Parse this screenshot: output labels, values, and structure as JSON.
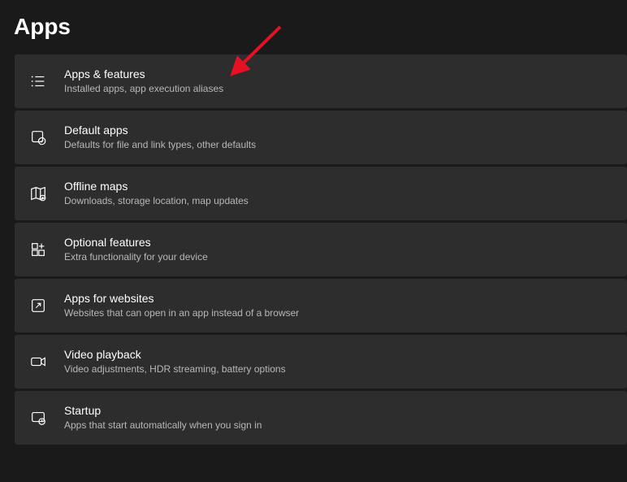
{
  "page": {
    "title": "Apps"
  },
  "items": [
    {
      "title": "Apps & features",
      "subtitle": "Installed apps, app execution aliases"
    },
    {
      "title": "Default apps",
      "subtitle": "Defaults for file and link types, other defaults"
    },
    {
      "title": "Offline maps",
      "subtitle": "Downloads, storage location, map updates"
    },
    {
      "title": "Optional features",
      "subtitle": "Extra functionality for your device"
    },
    {
      "title": "Apps for websites",
      "subtitle": "Websites that can open in an app instead of a browser"
    },
    {
      "title": "Video playback",
      "subtitle": "Video adjustments, HDR streaming, battery options"
    },
    {
      "title": "Startup",
      "subtitle": "Apps that start automatically when you sign in"
    }
  ],
  "annotation": {
    "arrow_color": "#e81123"
  }
}
